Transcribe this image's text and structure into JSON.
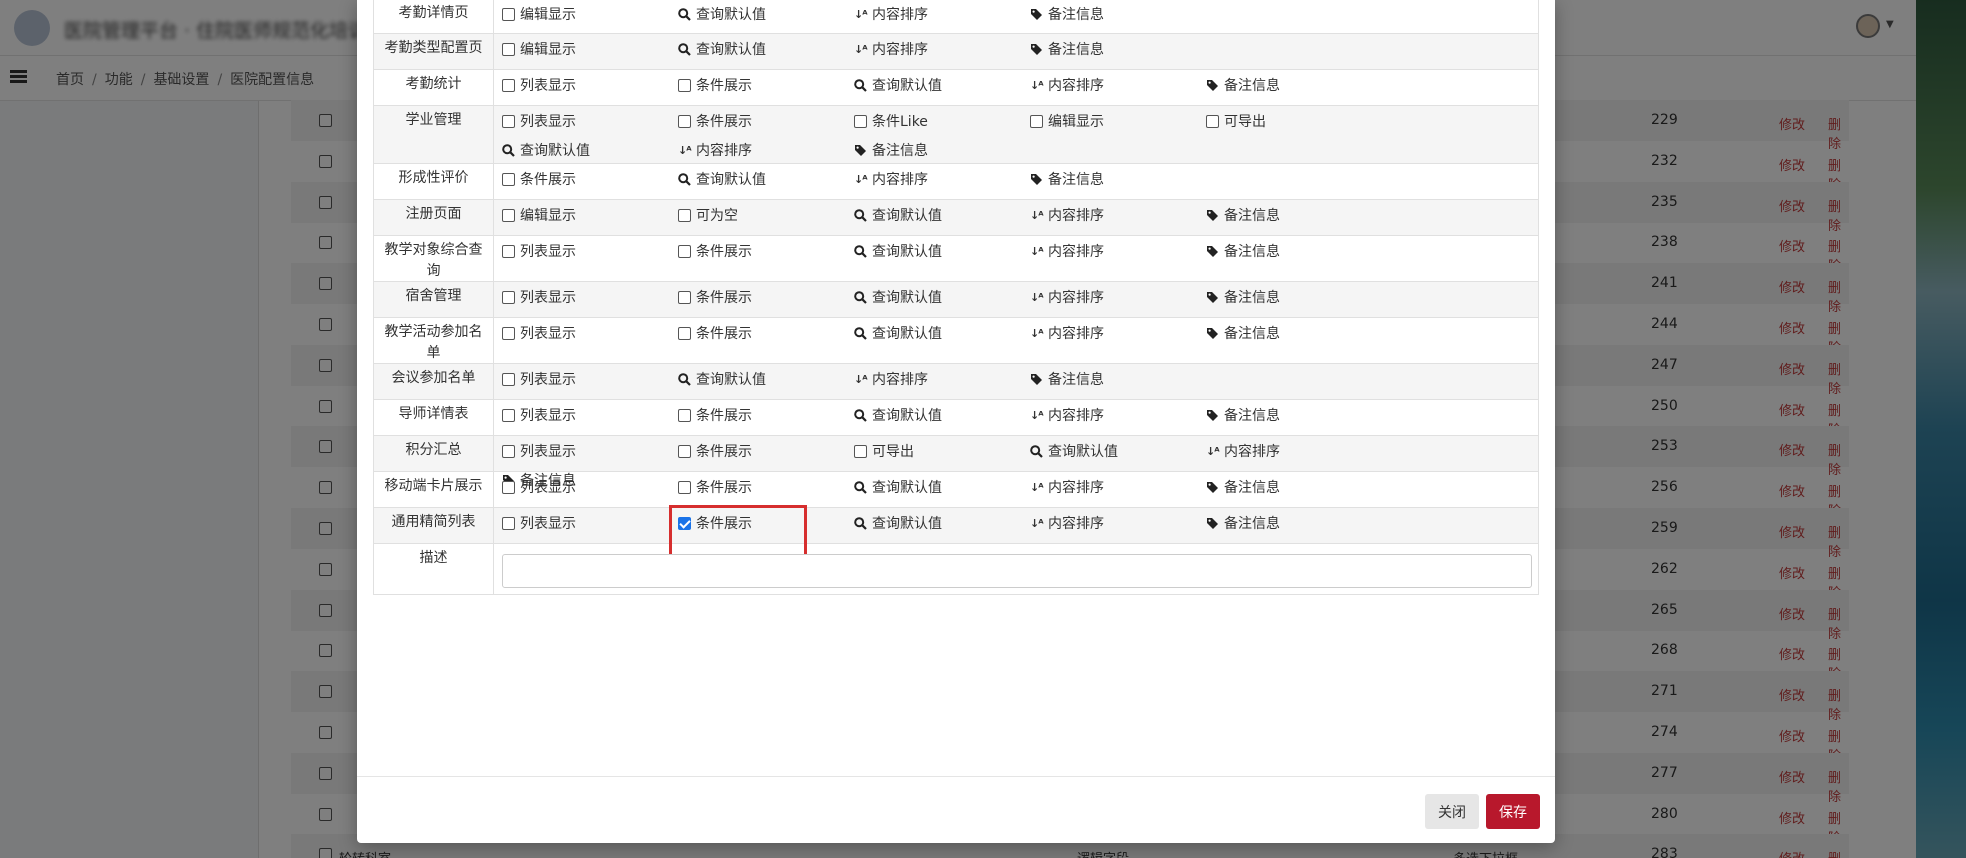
{
  "app": {
    "title": "医院管理平台 · 住院医师规范化培训",
    "breadcrumb": [
      "首页",
      "功能",
      "基础设置",
      "医院配置信息"
    ]
  },
  "background_table": {
    "edit_label": "修改",
    "delete_label": "删除",
    "ids": [
      "229",
      "232",
      "235",
      "238",
      "241",
      "244",
      "247",
      "250",
      "253",
      "256",
      "259",
      "262",
      "265",
      "268",
      "271",
      "274",
      "277",
      "280",
      "283"
    ],
    "last_row": {
      "name": "轮转科室",
      "type": "逻辑字段",
      "control": "多选下拉框"
    }
  },
  "modal": {
    "rows": [
      {
        "label": "考勤详情页",
        "options": [
          {
            "kind": "checkbox",
            "label": "编辑显示",
            "checked": false
          },
          {
            "kind": "search",
            "label": "查询默认值"
          },
          {
            "kind": "sort",
            "label": "内容排序"
          },
          {
            "kind": "tag",
            "label": "备注信息"
          }
        ]
      },
      {
        "label": "考勤类型配置页",
        "options": [
          {
            "kind": "checkbox",
            "label": "编辑显示",
            "checked": false
          },
          {
            "kind": "search",
            "label": "查询默认值"
          },
          {
            "kind": "sort",
            "label": "内容排序"
          },
          {
            "kind": "tag",
            "label": "备注信息"
          }
        ]
      },
      {
        "label": "考勤统计",
        "options": [
          {
            "kind": "checkbox",
            "label": "列表显示",
            "checked": false
          },
          {
            "kind": "checkbox",
            "label": "条件展示",
            "checked": false
          },
          {
            "kind": "search",
            "label": "查询默认值"
          },
          {
            "kind": "sort",
            "label": "内容排序"
          },
          {
            "kind": "tag",
            "label": "备注信息"
          }
        ]
      },
      {
        "label": "学业管理",
        "options": [
          {
            "kind": "checkbox",
            "label": "列表显示",
            "checked": false
          },
          {
            "kind": "checkbox",
            "label": "条件展示",
            "checked": false
          },
          {
            "kind": "checkbox",
            "label": "条件Like",
            "checked": false
          },
          {
            "kind": "checkbox",
            "label": "编辑显示",
            "checked": false
          },
          {
            "kind": "checkbox",
            "label": "可导出",
            "checked": false
          },
          {
            "kind": "search",
            "label": "查询默认值"
          },
          {
            "kind": "sort",
            "label": "内容排序"
          },
          {
            "kind": "tag",
            "label": "备注信息"
          }
        ]
      },
      {
        "label": "形成性评价",
        "options": [
          {
            "kind": "checkbox",
            "label": "条件展示",
            "checked": false
          },
          {
            "kind": "search",
            "label": "查询默认值"
          },
          {
            "kind": "sort",
            "label": "内容排序"
          },
          {
            "kind": "tag",
            "label": "备注信息"
          }
        ]
      },
      {
        "label": "注册页面",
        "options": [
          {
            "kind": "checkbox",
            "label": "编辑显示",
            "checked": false
          },
          {
            "kind": "checkbox",
            "label": "可为空",
            "checked": false
          },
          {
            "kind": "search",
            "label": "查询默认值"
          },
          {
            "kind": "sort",
            "label": "内容排序"
          },
          {
            "kind": "tag",
            "label": "备注信息"
          }
        ]
      },
      {
        "label": "教学对象综合查询",
        "options": [
          {
            "kind": "checkbox",
            "label": "列表显示",
            "checked": false
          },
          {
            "kind": "checkbox",
            "label": "条件展示",
            "checked": false
          },
          {
            "kind": "search",
            "label": "查询默认值"
          },
          {
            "kind": "sort",
            "label": "内容排序"
          },
          {
            "kind": "tag",
            "label": "备注信息"
          }
        ]
      },
      {
        "label": "宿舍管理",
        "options": [
          {
            "kind": "checkbox",
            "label": "列表显示",
            "checked": false
          },
          {
            "kind": "checkbox",
            "label": "条件展示",
            "checked": false
          },
          {
            "kind": "search",
            "label": "查询默认值"
          },
          {
            "kind": "sort",
            "label": "内容排序"
          },
          {
            "kind": "tag",
            "label": "备注信息"
          }
        ]
      },
      {
        "label": "教学活动参加名单",
        "options": [
          {
            "kind": "checkbox",
            "label": "列表显示",
            "checked": false
          },
          {
            "kind": "checkbox",
            "label": "条件展示",
            "checked": false
          },
          {
            "kind": "search",
            "label": "查询默认值"
          },
          {
            "kind": "sort",
            "label": "内容排序"
          },
          {
            "kind": "tag",
            "label": "备注信息"
          }
        ]
      },
      {
        "label": "会议参加名单",
        "options": [
          {
            "kind": "checkbox",
            "label": "列表显示",
            "checked": false
          },
          {
            "kind": "search",
            "label": "查询默认值"
          },
          {
            "kind": "sort",
            "label": "内容排序"
          },
          {
            "kind": "tag",
            "label": "备注信息"
          }
        ]
      },
      {
        "label": "导师详情表",
        "options": [
          {
            "kind": "checkbox",
            "label": "列表显示",
            "checked": false
          },
          {
            "kind": "checkbox",
            "label": "条件展示",
            "checked": false
          },
          {
            "kind": "search",
            "label": "查询默认值"
          },
          {
            "kind": "sort",
            "label": "内容排序"
          },
          {
            "kind": "tag",
            "label": "备注信息"
          }
        ]
      },
      {
        "label": "积分汇总",
        "options": [
          {
            "kind": "checkbox",
            "label": "列表显示",
            "checked": false
          },
          {
            "kind": "checkbox",
            "label": "条件展示",
            "checked": false
          },
          {
            "kind": "checkbox",
            "label": "可导出",
            "checked": false
          },
          {
            "kind": "search",
            "label": "查询默认值"
          },
          {
            "kind": "sort",
            "label": "内容排序"
          },
          {
            "kind": "tag",
            "label": "备注信息"
          }
        ]
      },
      {
        "label": "移动端卡片展示",
        "options": [
          {
            "kind": "checkbox",
            "label": "列表显示",
            "checked": false
          },
          {
            "kind": "checkbox",
            "label": "条件展示",
            "checked": false
          },
          {
            "kind": "search",
            "label": "查询默认值"
          },
          {
            "kind": "sort",
            "label": "内容排序"
          },
          {
            "kind": "tag",
            "label": "备注信息"
          }
        ]
      },
      {
        "label": "通用精简列表",
        "highlight": true,
        "options": [
          {
            "kind": "checkbox",
            "label": "列表显示",
            "checked": false
          },
          {
            "kind": "checkbox",
            "label": "条件展示",
            "checked": true
          },
          {
            "kind": "search",
            "label": "查询默认值"
          },
          {
            "kind": "sort",
            "label": "内容排序"
          },
          {
            "kind": "tag",
            "label": "备注信息"
          }
        ]
      }
    ],
    "description": {
      "label": "描述",
      "value": "",
      "placeholder": ""
    },
    "buttons": {
      "close": "关闭",
      "save": "保存"
    }
  },
  "colors": {
    "accent_save": "#b8182c",
    "checkbox_checked": "#1a73e8",
    "highlight_border": "#d62e2e",
    "action_link": "#c23b3b"
  }
}
